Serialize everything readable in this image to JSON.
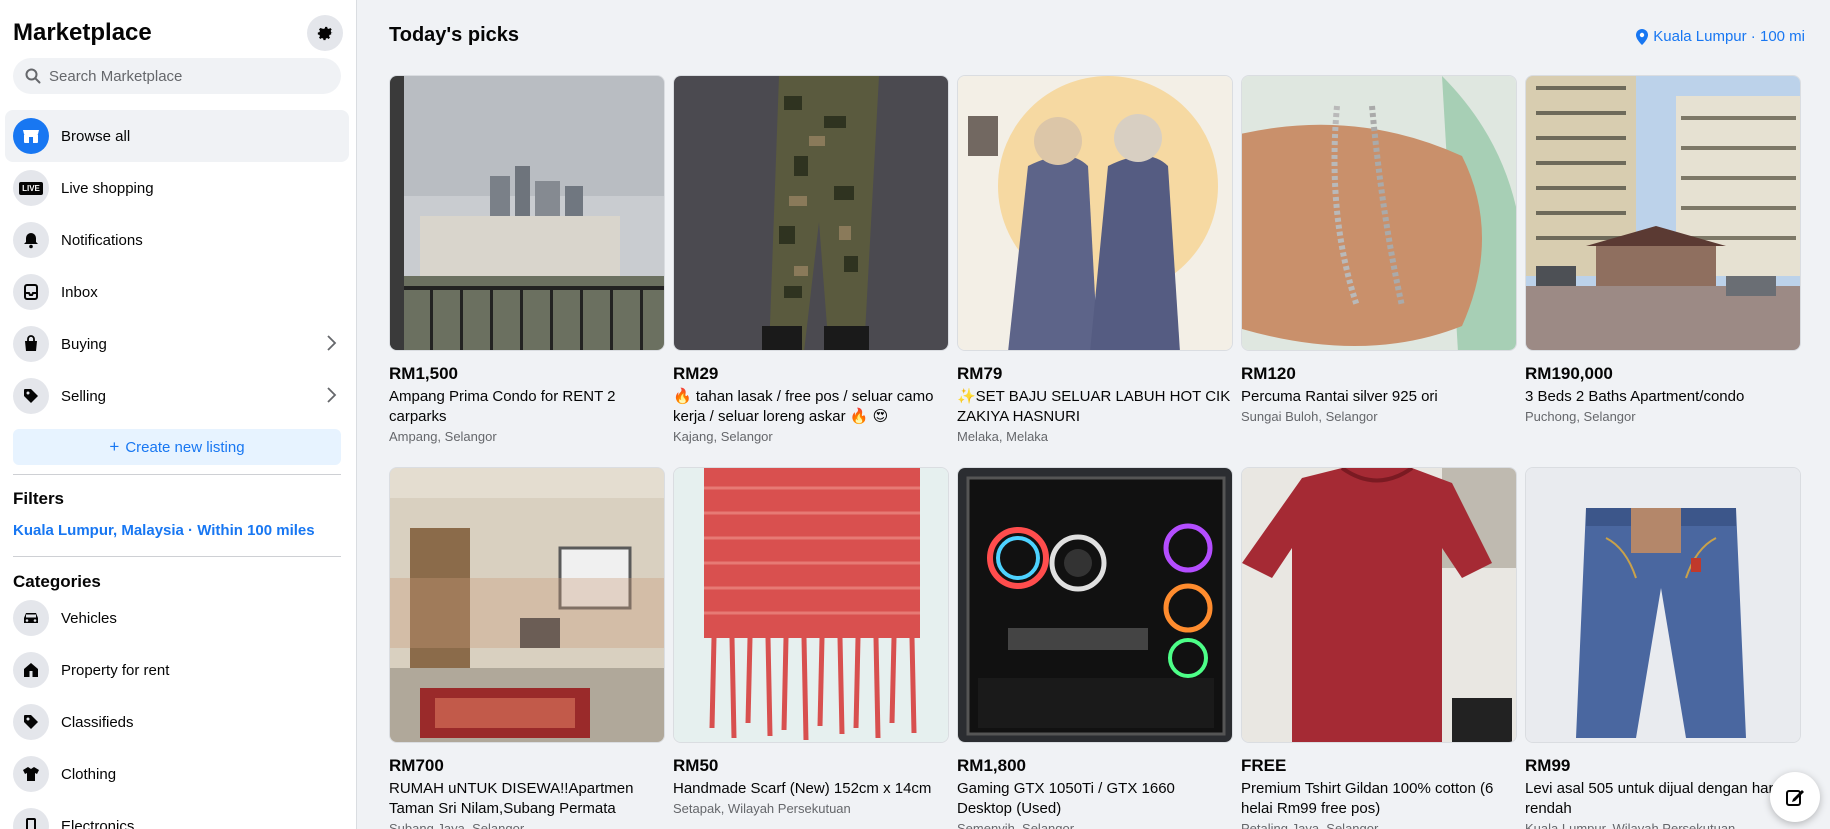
{
  "sidebar": {
    "title": "Marketplace",
    "settings_icon": "gear-icon",
    "search_placeholder": "Search Marketplace",
    "nav": [
      {
        "label": "Browse all",
        "icon": "storefront-icon",
        "active": true
      },
      {
        "label": "Live shopping",
        "icon": "live-icon"
      },
      {
        "label": "Notifications",
        "icon": "bell-icon"
      },
      {
        "label": "Inbox",
        "icon": "inbox-icon"
      },
      {
        "label": "Buying",
        "icon": "shopping-bag-icon",
        "chevron": true
      },
      {
        "label": "Selling",
        "icon": "tag-icon",
        "chevron": true
      }
    ],
    "live_badge": "LIVE",
    "create_listing": "Create new listing",
    "filters_title": "Filters",
    "filters_location": "Kuala Lumpur, Malaysia · Within 100 miles",
    "categories_title": "Categories",
    "categories": [
      {
        "label": "Vehicles",
        "icon": "car-icon"
      },
      {
        "label": "Property for rent",
        "icon": "house-icon"
      },
      {
        "label": "Classifieds",
        "icon": "tag-icon"
      },
      {
        "label": "Clothing",
        "icon": "shirt-icon"
      },
      {
        "label": "Electronics",
        "icon": "phone-icon"
      }
    ]
  },
  "main": {
    "title": "Today's picks",
    "location": "Kuala Lumpur · 100 mi",
    "listings": [
      {
        "price": "RM1,500",
        "title": "Ampang Prima Condo for RENT 2 carparks",
        "location": "Ampang, Selangor"
      },
      {
        "price": "RM29",
        "title": "🔥 tahan lasak / free pos / seluar camo kerja / seluar loreng askar 🔥 😍",
        "location": "Kajang, Selangor"
      },
      {
        "price": "RM79",
        "title": "✨SET BAJU SELUAR LABUH HOT CIK ZAKIYA HASNURI",
        "location": "Melaka, Melaka"
      },
      {
        "price": "RM120",
        "title": "Percuma Rantai silver 925 ori",
        "location": "Sungai Buloh, Selangor"
      },
      {
        "price": "RM190,000",
        "title": "3 Beds 2 Baths Apartment/condo",
        "location": "Puchong, Selangor"
      },
      {
        "price": "RM700",
        "title": "RUMAH uNTUK DISEWA!!Apartmen Taman Sri Nilam,Subang Permata",
        "location": "Subang Jaya, Selangor"
      },
      {
        "price": "RM50",
        "title": "Handmade Scarf (New) 152cm x 14cm",
        "location": "Setapak, Wilayah Persekutuan"
      },
      {
        "price": "RM1,800",
        "title": "Gaming GTX 1050Ti / GTX 1660 Desktop (Used)",
        "location": "Semenyih, Selangor"
      },
      {
        "price": "FREE",
        "title": "Premium Tshirt Gildan 100% cotton (6 helai Rm99 free pos)",
        "location": "Petaling Jaya, Selangor"
      },
      {
        "price": "RM99",
        "title": "Levi asal 505 untuk dijual dengan harga rendah",
        "location": "Kuala Lumpur, Wilayah Persekutuan"
      }
    ]
  },
  "fab_icon": "compose-icon",
  "colors": {
    "accent": "#1877f2",
    "bg": "#f0f2f5",
    "secondary_text": "#65676b"
  }
}
